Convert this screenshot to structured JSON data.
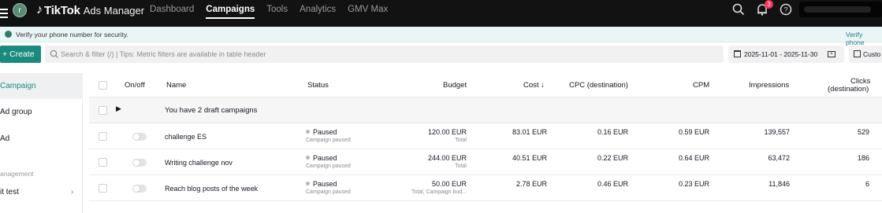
{
  "header": {
    "avatar_letter": "r",
    "brand": "TikTok",
    "product": "Ads Manager",
    "nav": [
      {
        "label": "Dashboard",
        "active": false
      },
      {
        "label": "Campaigns",
        "active": true
      },
      {
        "label": "Tools",
        "active": false
      },
      {
        "label": "Analytics",
        "active": false
      },
      {
        "label": "GMV Max",
        "active": false
      }
    ],
    "notification_count": "3",
    "icons": [
      "search-icon",
      "bell-icon",
      "help-icon"
    ]
  },
  "notice": {
    "text": "Verify your phone number for security.",
    "link": "Verify phone"
  },
  "toolbar": {
    "create_label": "+ Create",
    "search_placeholder": "Search & filter (/) | Tips: Metric filters are available in table header",
    "date_range": "2025-11-01 - 2025-11-30",
    "custom_label": "Custo"
  },
  "sidebar": {
    "items": [
      "Campaign",
      "Ad group",
      "Ad"
    ],
    "section": "anagement",
    "sub_item": "it test"
  },
  "table": {
    "columns": {
      "onoff": "On/off",
      "name": "Name",
      "status": "Status",
      "budget": "Budget",
      "cost": "Cost ↓",
      "cpc": "CPC (destination)",
      "cpm": "CPM",
      "impressions": "Impressions",
      "clicks_line1": "Clicks",
      "clicks_line2": "(destination)"
    },
    "draft_text": "You have 2 draft campaigns",
    "rows": [
      {
        "name": "challenge ES",
        "status": "Paused",
        "status_sub": "Campaign paused",
        "budget": "120.00 EUR",
        "budget_sub": "Total",
        "cost": "83.01 EUR",
        "cpc": "0.16 EUR",
        "cpm": "0.59 EUR",
        "impressions": "139,557",
        "clicks": "529"
      },
      {
        "name": "Writing challenge nov",
        "status": "Paused",
        "status_sub": "Campaign paused",
        "budget": "244.00 EUR",
        "budget_sub": "Total",
        "cost": "40.51 EUR",
        "cpc": "0.22 EUR",
        "cpm": "0.64 EUR",
        "impressions": "63,472",
        "clicks": "186"
      },
      {
        "name": "Reach blog posts of the week",
        "status": "Paused",
        "status_sub": "Campaign paused",
        "budget": "50.00 EUR",
        "budget_sub": "Total, Campaign bud...",
        "cost": "2.78 EUR",
        "cpc": "0.46 EUR",
        "cpm": "0.23 EUR",
        "impressions": "11,846",
        "clicks": "6"
      }
    ]
  },
  "colors": {
    "topbar": "#121212",
    "accent": "#1b8a7e",
    "badge": "#fe2c55"
  }
}
